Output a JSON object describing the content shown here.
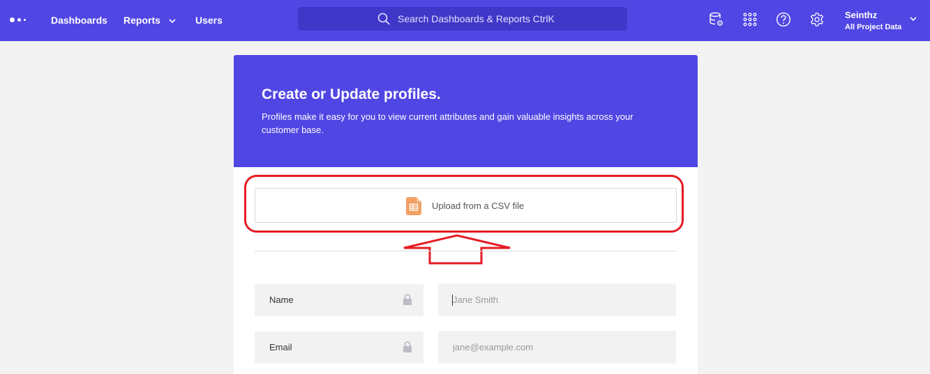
{
  "nav": {
    "dashboards": "Dashboards",
    "reports": "Reports",
    "users": "Users"
  },
  "search": {
    "placeholder": "Search Dashboards & Reports CtrlK"
  },
  "user": {
    "name": "Seinthz",
    "project": "All Project Data"
  },
  "header": {
    "title": "Create or Update profiles.",
    "description": "Profiles make it easy for you to view current attributes and gain valuable insights across your customer base."
  },
  "upload": {
    "label": "Upload from a CSV file"
  },
  "fields": [
    {
      "label": "Name",
      "placeholder": "Jane Smith"
    },
    {
      "label": "Email",
      "placeholder": "jane@example.com"
    }
  ],
  "colors": {
    "brand": "#5046e4",
    "annotation": "#e51b23",
    "csv": "#f0a064"
  },
  "icons": [
    "logo-icon",
    "search-icon",
    "database-settings-icon",
    "apps-grid-icon",
    "help-icon",
    "settings-gear-icon",
    "chevron-down-icon",
    "csv-file-icon",
    "lock-icon"
  ]
}
